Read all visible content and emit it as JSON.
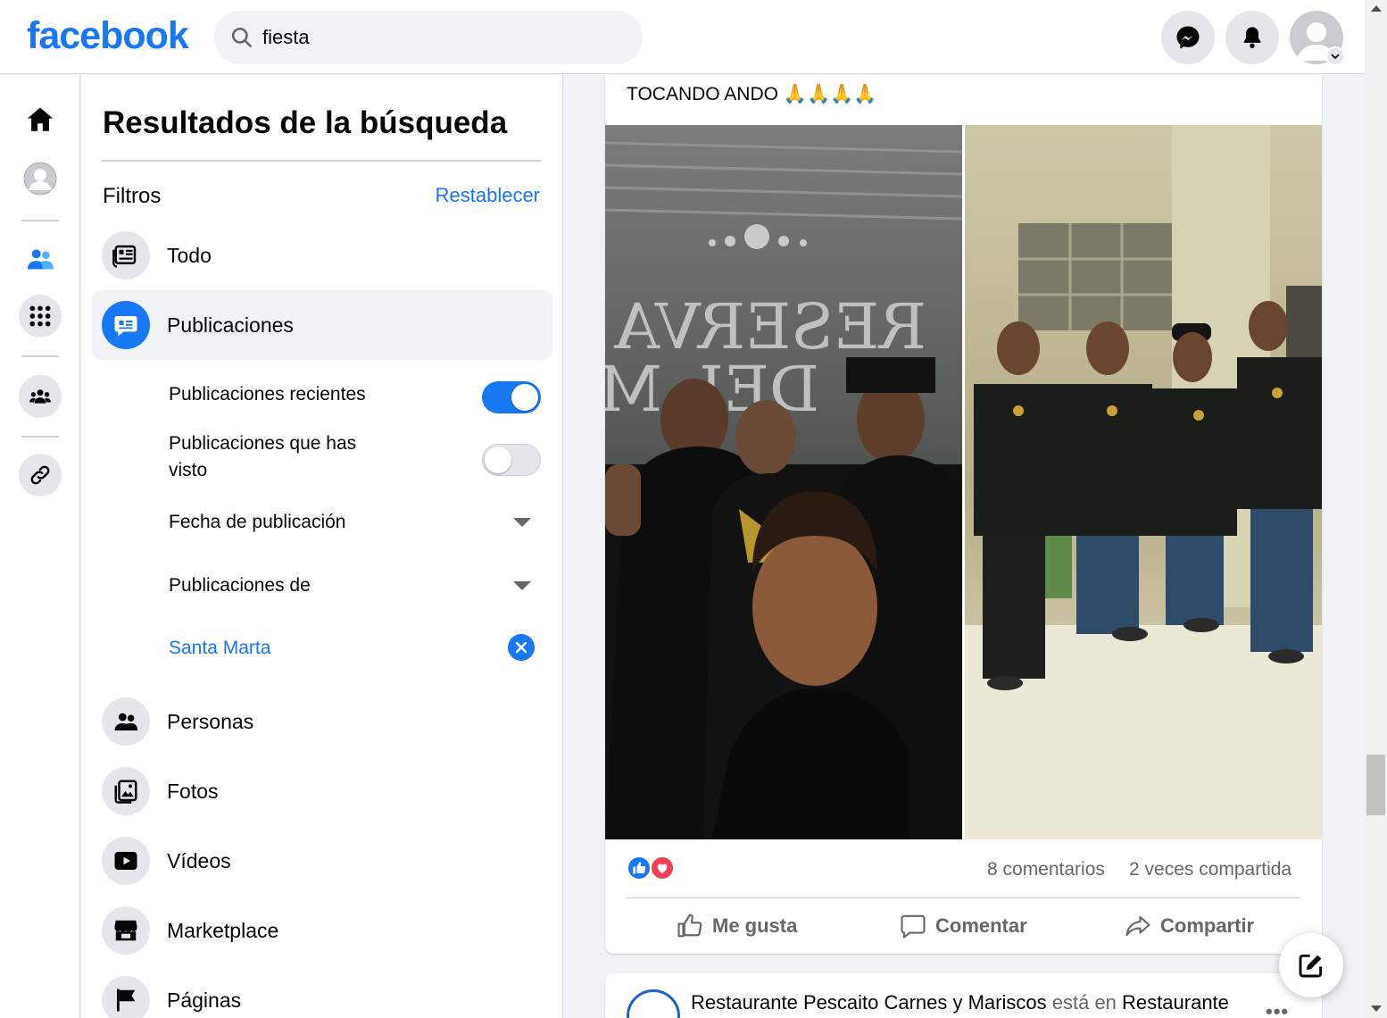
{
  "header": {
    "logo": "facebook",
    "search_value": "fiesta"
  },
  "panel": {
    "title": "Resultados de la búsqueda",
    "filters_label": "Filtros",
    "reset_label": "Restablecer",
    "nav": {
      "todo": "Todo",
      "publicaciones": "Publicaciones",
      "personas": "Personas",
      "fotos": "Fotos",
      "videos": "Vídeos",
      "marketplace": "Marketplace",
      "paginas": "Páginas"
    },
    "sub": {
      "recent": "Publicaciones recientes",
      "recent_on": true,
      "seen_line1": "Publicaciones que has",
      "seen_line2": "visto",
      "seen_on": false,
      "date": "Fecha de publicación",
      "from": "Publicaciones de",
      "location": "Santa Marta"
    }
  },
  "post": {
    "text": "TOCANDO ANDO 🙏🙏🙏🙏",
    "comments": "8 comentarios",
    "shares": "2 veces compartida",
    "like": "Me gusta",
    "comment": "Comentar",
    "share": "Compartir"
  },
  "post2": {
    "author": "Restaurante Pescaito Carnes y Mariscos",
    "connector": "está en",
    "place": "Restaurante",
    "more": "•••"
  },
  "colors": {
    "brand": "#1877f2",
    "background": "#f0f2f5",
    "muted_text": "#65676b"
  }
}
